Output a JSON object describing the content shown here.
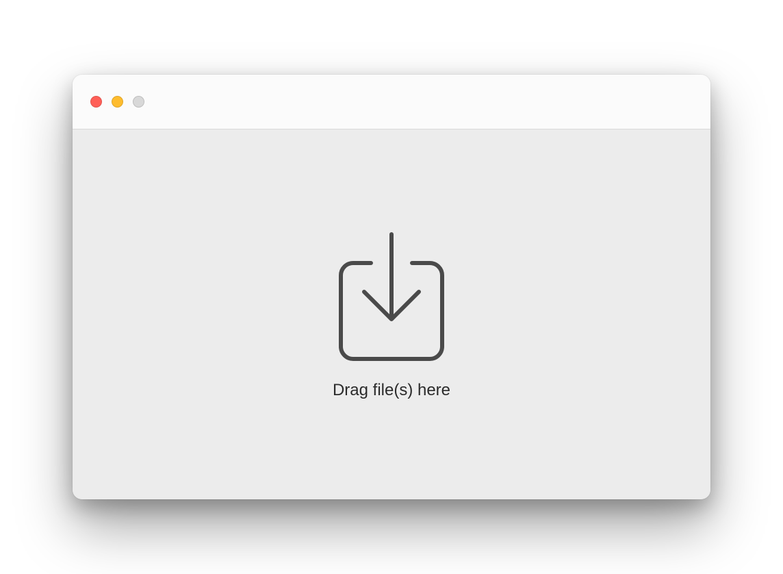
{
  "window": {
    "traffic_lights": {
      "close": "close",
      "minimize": "minimize",
      "zoom": "zoom"
    }
  },
  "dropzone": {
    "label": "Drag file(s) here",
    "icon_name": "download-tray-icon",
    "icon_stroke": "#4a4a4a"
  }
}
